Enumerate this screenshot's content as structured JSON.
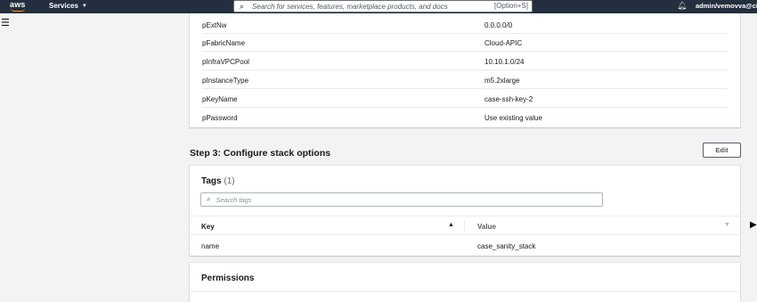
{
  "topbar": {
    "logo": "aws",
    "services_label": "Services",
    "services_caret": "▼",
    "search_placeholder": "Search for services, features, marketplace products, and docs",
    "search_shortcut": "[Option+S]",
    "bell_icon": "bell-icon",
    "user_label": "admin/vemovva@ci"
  },
  "parameters": [
    {
      "key": "pExtNw",
      "value": "0.0.0.0/0"
    },
    {
      "key": "pFabricName",
      "value": "Cloud-APIC"
    },
    {
      "key": "pInfraVPCPool",
      "value": "10.10.1.0/24"
    },
    {
      "key": "pInstanceType",
      "value": "m5.2xlarge"
    },
    {
      "key": "pKeyName",
      "value": "case-ssh-key-2"
    },
    {
      "key": "pPassword",
      "value": "Use existing value"
    }
  ],
  "step3": {
    "title": "Step 3: Configure stack options",
    "edit_label": "Edit"
  },
  "tags": {
    "title": "Tags",
    "count": "(1)",
    "search_placeholder": "Search tags",
    "columns": {
      "key": "Key",
      "value": "Value"
    },
    "rows": [
      {
        "key": "name",
        "value": "case_sanity_stack"
      }
    ]
  },
  "permissions": {
    "title": "Permissions"
  }
}
